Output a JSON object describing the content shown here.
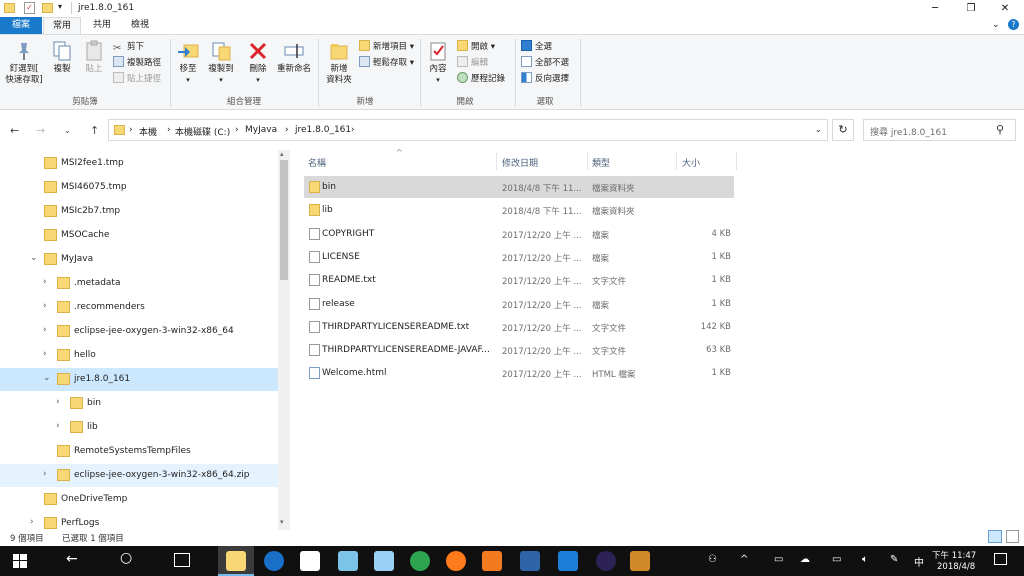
{
  "window": {
    "title": "jre1.8.0_161",
    "controls": {
      "minimize": "─",
      "maximize": "❐",
      "close": "✕"
    }
  },
  "tabs": [
    "檔案",
    "常用",
    "共用",
    "檢視"
  ],
  "ribbon": {
    "clipboard": {
      "pin_label_1": "釘選到[",
      "pin_label_2": "快速存取]",
      "copy": "複製",
      "paste": "貼上",
      "cut": "剪下",
      "copy_path": "複製路徑",
      "paste_shortcut": "貼上捷徑",
      "group": "剪貼簿"
    },
    "organize": {
      "move_to": "移至",
      "copy_to": "複製到",
      "delete": "刪除",
      "rename": "重新命名",
      "group": "組合管理"
    },
    "new": {
      "new_folder_1": "新增",
      "new_folder_2": "資料夾",
      "new_item": "新增項目",
      "easy_access": "輕鬆存取",
      "group": "新增"
    },
    "open": {
      "properties": "內容",
      "open": "開啟",
      "edit": "編輯",
      "history": "歷程記錄",
      "group": "開啟"
    },
    "select": {
      "select_all": "全選",
      "select_none": "全部不選",
      "invert": "反向選擇",
      "group": "選取"
    }
  },
  "address": {
    "crumbs": [
      "本機",
      "本機磁碟 (C:)",
      "MyJava",
      "jre1.8.0_161"
    ],
    "search_placeholder": "搜尋 jre1.8.0_161"
  },
  "nav_tree": [
    {
      "label": "MSI2fee1.tmp",
      "level": 1,
      "expand": ""
    },
    {
      "label": "MSI46075.tmp",
      "level": 1,
      "expand": ""
    },
    {
      "label": "MSIc2b7.tmp",
      "level": 1,
      "expand": ""
    },
    {
      "label": "MSOCache",
      "level": 1,
      "expand": ""
    },
    {
      "label": "MyJava",
      "level": 1,
      "expand": "⌄"
    },
    {
      "label": ".metadata",
      "level": 2,
      "expand": "›"
    },
    {
      "label": ".recommenders",
      "level": 2,
      "expand": "›"
    },
    {
      "label": "eclipse-jee-oxygen-3-win32-x86_64",
      "level": 2,
      "expand": "›"
    },
    {
      "label": "hello",
      "level": 2,
      "expand": "›"
    },
    {
      "label": "jre1.8.0_161",
      "level": 2,
      "expand": "⌄"
    },
    {
      "label": "bin",
      "level": 3,
      "expand": "›"
    },
    {
      "label": "lib",
      "level": 3,
      "expand": "›"
    },
    {
      "label": "RemoteSystemsTempFiles",
      "level": 2,
      "expand": ""
    },
    {
      "label": "eclipse-jee-oxygen-3-win32-x86_64.zip",
      "level": 2,
      "expand": "›"
    },
    {
      "label": "OneDriveTemp",
      "level": 1,
      "expand": ""
    },
    {
      "label": "PerfLogs",
      "level": 1,
      "expand": "›"
    }
  ],
  "columns": {
    "name": "名稱",
    "modified": "修改日期",
    "type": "類型",
    "size": "大小"
  },
  "files": [
    {
      "name": "bin",
      "date": "2018/4/8 下午 11...",
      "type": "檔案資料夾",
      "size": "",
      "kind": "folder"
    },
    {
      "name": "lib",
      "date": "2018/4/8 下午 11...",
      "type": "檔案資料夾",
      "size": "",
      "kind": "folder"
    },
    {
      "name": "COPYRIGHT",
      "date": "2017/12/20 上午 ...",
      "type": "檔案",
      "size": "4 KB",
      "kind": "file"
    },
    {
      "name": "LICENSE",
      "date": "2017/12/20 上午 ...",
      "type": "檔案",
      "size": "1 KB",
      "kind": "file"
    },
    {
      "name": "README.txt",
      "date": "2017/12/20 上午 ...",
      "type": "文字文件",
      "size": "1 KB",
      "kind": "file"
    },
    {
      "name": "release",
      "date": "2017/12/20 上午 ...",
      "type": "檔案",
      "size": "1 KB",
      "kind": "file"
    },
    {
      "name": "THIRDPARTYLICENSEREADME.txt",
      "date": "2017/12/20 上午 ...",
      "type": "文字文件",
      "size": "142 KB",
      "kind": "file"
    },
    {
      "name": "THIRDPARTYLICENSEREADME-JAVAF...",
      "date": "2017/12/20 上午 ...",
      "type": "文字文件",
      "size": "63 KB",
      "kind": "file"
    },
    {
      "name": "Welcome.html",
      "date": "2017/12/20 上午 ...",
      "type": "HTML 檔案",
      "size": "1 KB",
      "kind": "html"
    }
  ],
  "status": {
    "count": "9 個項目",
    "selected": "已選取 1 個項目"
  },
  "taskbar": {
    "time": "下午 11:47",
    "date": "2018/4/8",
    "ime": "中",
    "apps": [
      "file-explorer-icon",
      "media-player-icon",
      "chrome-icon",
      "notepad-icon",
      "paint-icon",
      "green-app-icon",
      "firefox-icon",
      "xampp-icon",
      "virtualbox-icon",
      "edge-icon",
      "eclipse-icon",
      "game-icon"
    ]
  },
  "colors": {
    "accent": "#1979ca",
    "selection": "#cce8ff",
    "folder": "#f8d775"
  }
}
